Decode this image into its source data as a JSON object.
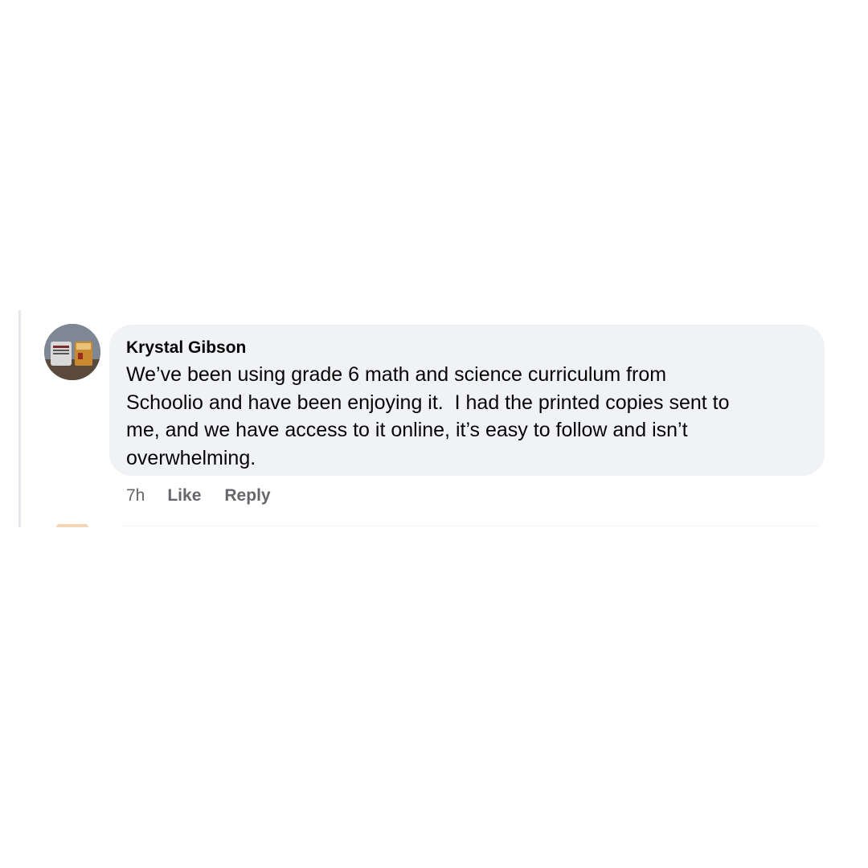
{
  "comment": {
    "author": "Krystal Gibson",
    "text": "We’ve been using grade 6 math and science curriculum from\nSchoolio and have been enjoying it.  I had the printed copies sent to\nme, and we have access to it online, it’s easy to follow and isn’t\noverwhelming.",
    "timestamp": "7h",
    "like_label": "Like",
    "reply_label": "Reply",
    "avatar_icon": "profile-photo"
  },
  "colors": {
    "bubble_background": "#f0f2f5",
    "text_primary": "#050505",
    "text_secondary": "#65676b",
    "thread_line": "#e4e6eb"
  }
}
